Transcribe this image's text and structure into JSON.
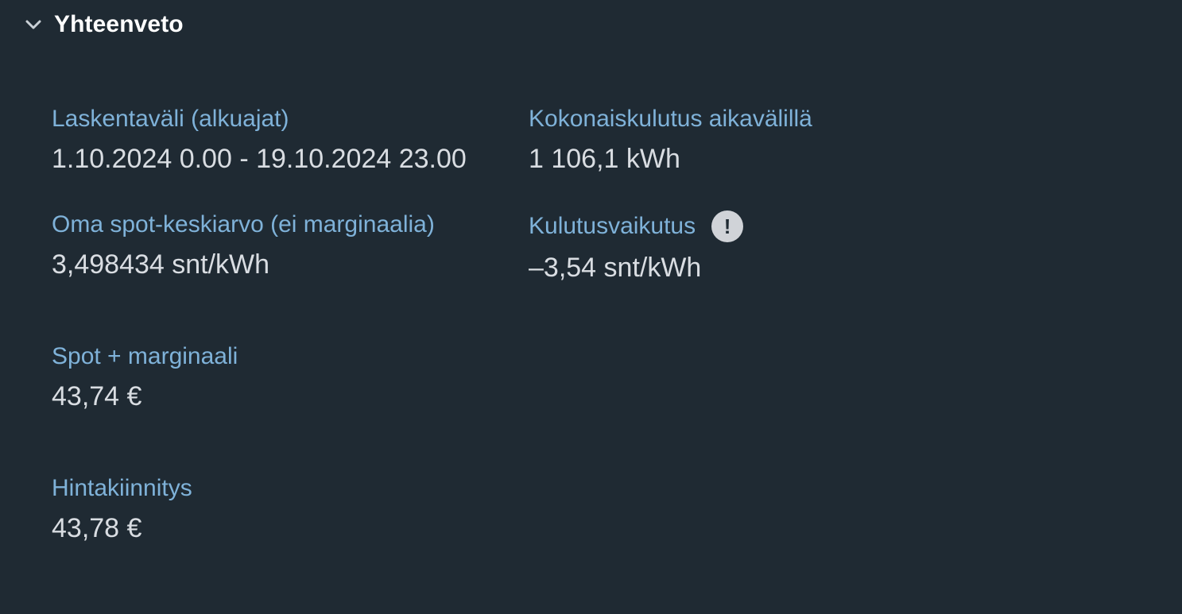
{
  "section": {
    "title": "Yhteenveto",
    "toggle_icon": "chevron-down-icon"
  },
  "fields": {
    "calculation_period": {
      "label": "Laskentaväli (alkuajat)",
      "value": "1.10.2024 0.00 - 19.10.2024 23.00"
    },
    "total_consumption": {
      "label": "Kokonaiskulutus aikavälillä",
      "value": "1 106,1 kWh"
    },
    "own_spot_average": {
      "label": "Oma spot-keskiarvo (ei marginaalia)",
      "value": "3,498434 snt/kWh"
    },
    "consumption_effect": {
      "label": "Kulutusvaikutus",
      "value": "–3,54 snt/kWh",
      "info_icon": "exclamation-icon",
      "info_symbol": "!"
    },
    "spot_plus_margin": {
      "label": "Spot + marginaali",
      "value": "43,74 €"
    },
    "price_lock": {
      "label": "Hintakiinnitys",
      "value": "43,78 €"
    }
  },
  "colors": {
    "background": "#1f2a33",
    "label": "#7fb2d9",
    "value": "#d9dde2",
    "title": "#ffffff",
    "info_icon_bg": "#d0d3d8"
  }
}
